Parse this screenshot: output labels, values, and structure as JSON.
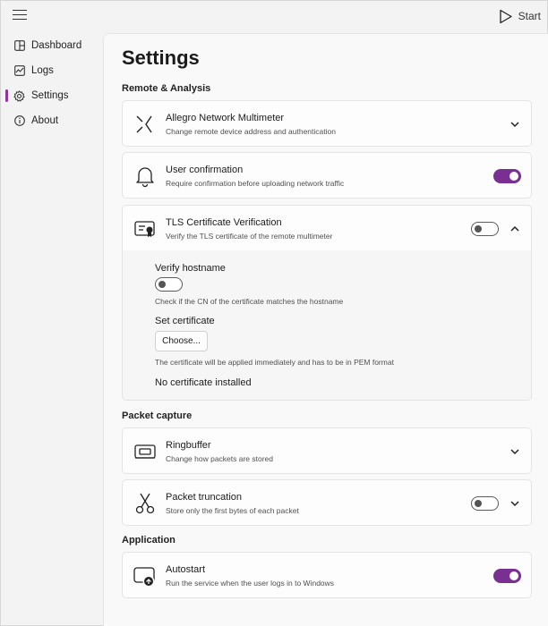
{
  "topbar": {
    "start_label": "Start"
  },
  "nav": {
    "items": [
      {
        "label": "Dashboard",
        "icon": "dashboard-icon"
      },
      {
        "label": "Logs",
        "icon": "logs-icon"
      },
      {
        "label": "Settings",
        "icon": "gear-icon",
        "active": true
      },
      {
        "label": "About",
        "icon": "info-icon"
      }
    ]
  },
  "page": {
    "title": "Settings"
  },
  "sections": {
    "remote": "Remote & Analysis",
    "capture": "Packet capture",
    "application": "Application"
  },
  "cards": {
    "multimeter": {
      "title": "Allegro Network Multimeter",
      "subtitle": "Change remote device address and authentication",
      "icon": "network-icon"
    },
    "confirmation": {
      "title": "User confirmation",
      "subtitle": "Require confirmation before uploading network traffic",
      "icon": "bell-icon",
      "toggle_on": true
    },
    "tls": {
      "title": "TLS Certificate Verification",
      "subtitle": "Verify the TLS certificate of the remote multimeter",
      "icon": "certificate-icon",
      "toggle_on": false
    },
    "ringbuffer": {
      "title": "Ringbuffer",
      "subtitle": "Change how packets are stored",
      "icon": "ringbuffer-icon"
    },
    "truncation": {
      "title": "Packet truncation",
      "subtitle": "Store only the first bytes of each packet",
      "icon": "scissors-icon",
      "toggle_on": false
    },
    "autostart": {
      "title": "Autostart",
      "subtitle": "Run the service when the user logs in to Windows",
      "icon": "autostart-icon",
      "toggle_on": true
    }
  },
  "tls_expanded": {
    "verify_hostname_label": "Verify hostname",
    "verify_hostname_on": false,
    "verify_hostname_help": "Check if the CN of the certificate matches the hostname",
    "set_certificate_label": "Set certificate",
    "choose_button": "Choose...",
    "certificate_help": "The certificate will be applied immediately and has to be in PEM format",
    "certificate_status": "No certificate installed"
  },
  "colors": {
    "accent": "#7a2f93"
  }
}
